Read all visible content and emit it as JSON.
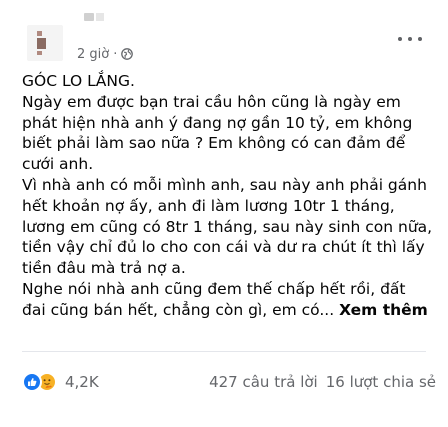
{
  "post": {
    "time": "2 giờ",
    "separator": "·",
    "paragraphs": [
      "GÓC LO LẮNG.",
      "Ngày em được bạn trai cầu hôn cũng là ngày em phát hiện nhà anh ý đang nợ gần 10 tỷ, em không biết phải làm sao nữa ? Em không có can đảm để cưới anh.",
      "Vì nhà anh có mỗi mình anh, sau này anh phải gánh hết khoản nợ ấy, anh đi làm lương 10tr 1 tháng, lương em cũng có 8tr 1 tháng, sau này sinh con nữa, tiền vậy chỉ đủ lo cho con cái và dư ra chút ít thì lấy tiền đâu mà trả nợ a.",
      "Nghe nói nhà anh cũng đem thế chấp hết rồi, đất đai cũng bán hết, chẳng còn gì, em có..."
    ],
    "see_more": "Xem thêm"
  },
  "footer": {
    "reaction_count": "4,2K",
    "comments": "427 câu trả lời",
    "shares": "16 lượt chia sẻ"
  },
  "icons": {
    "reaction_1": "like-icon",
    "reaction_2": "care-icon",
    "privacy": "globe-icon",
    "menu": "more-icon"
  },
  "colors": {
    "text": "#050505",
    "secondary": "#65676b",
    "like": "#1877f2",
    "care": "#f7b125"
  }
}
